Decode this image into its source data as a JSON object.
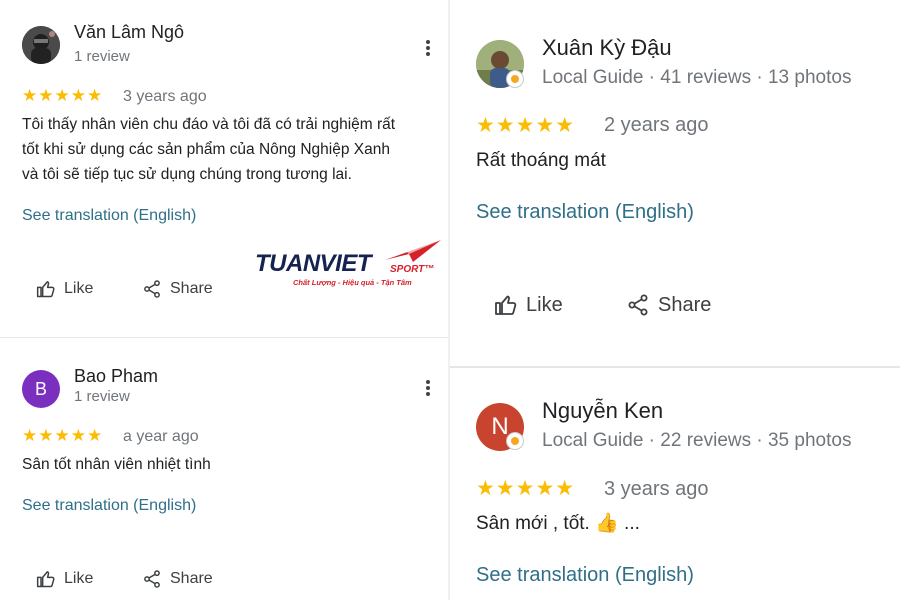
{
  "reviews": [
    {
      "name": "Văn Lâm Ngô",
      "subtitle": "1 review",
      "stars": "★★★★★",
      "rating": 5,
      "date": "3 years ago",
      "lines": [
        "Tôi thấy nhân viên chu đáo và tôi đã có trải nghiệm rất",
        "tốt khi sử dụng các sản phẩm của Nông Nghiệp Xanh",
        "và tôi sẽ tiếp tục sử dụng chúng trong tương lai."
      ],
      "translate": "See translation (English)",
      "like": "Like",
      "share": "Share"
    },
    {
      "name": "Bao Pham",
      "initial": "B",
      "subtitle": "1 review",
      "stars": "★★★★★",
      "rating": 5,
      "date": "a year ago",
      "lines": [
        "Sân tốt nhân viên nhiệt tình"
      ],
      "translate": "See translation (English)",
      "like": "Like",
      "share": "Share"
    },
    {
      "name": "Xuân Kỳ Đậu",
      "subtitle": "Local Guide · 41 reviews · 13 photos",
      "stars": "★★★★★",
      "rating": 5,
      "date": "2 years ago",
      "lines": [
        "Rất thoáng mát"
      ],
      "translate": "See translation (English)",
      "like": "Like",
      "share": "Share"
    },
    {
      "name": "Nguyễn Ken",
      "initial": "N",
      "subtitle": "Local Guide · 22 reviews · 35 photos",
      "stars": "★★★★★",
      "rating": 5,
      "date": "3 years ago",
      "lines": [
        "Sân mới , tốt. 👍 ..."
      ],
      "translate": "See translation (English)"
    }
  ],
  "logo": {
    "brand": "TUANVIET",
    "sport": "SPORT™",
    "tagline": "Chất Lượng - Hiệu quả - Tận Tâm"
  },
  "colors": {
    "star": "#fbbc04",
    "link": "#2f6f88",
    "avatar_b": "#7b2fbf",
    "avatar_n": "#c8442e",
    "logo_navy": "#16224f",
    "logo_red": "#d6202a"
  }
}
